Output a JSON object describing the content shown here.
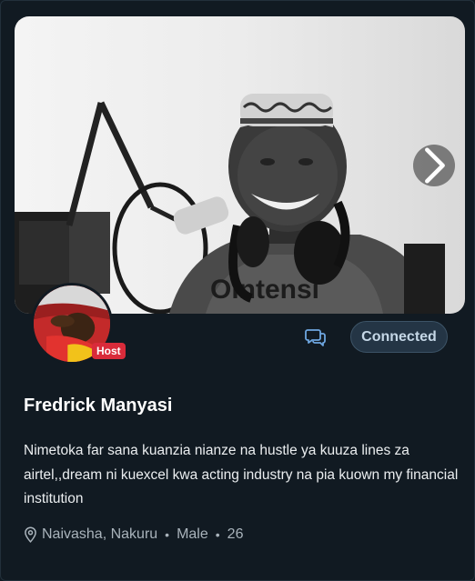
{
  "profile": {
    "name": "Fredrick Manyasi",
    "host_badge": "Host",
    "bio": "Nimetoka far sana kuanzia nianze na hustle ya kuuza lines za airtel,,dream ni kuexcel kwa acting industry na pia kuown my financial institution",
    "location": "Naivasha, Nakuru",
    "gender": "Male",
    "age": "26",
    "separator": "•"
  },
  "actions": {
    "connect_label": "Connected"
  },
  "icons": {
    "next": "chevron-right-icon",
    "message": "chat-bubbles-icon",
    "location": "location-pin-icon"
  },
  "colors": {
    "background": "#111a22",
    "connected_bg": "#243545",
    "connected_text": "#c5d7e6",
    "host_badge": "#d92b3a",
    "accent_icon": "#6ea6e0"
  }
}
